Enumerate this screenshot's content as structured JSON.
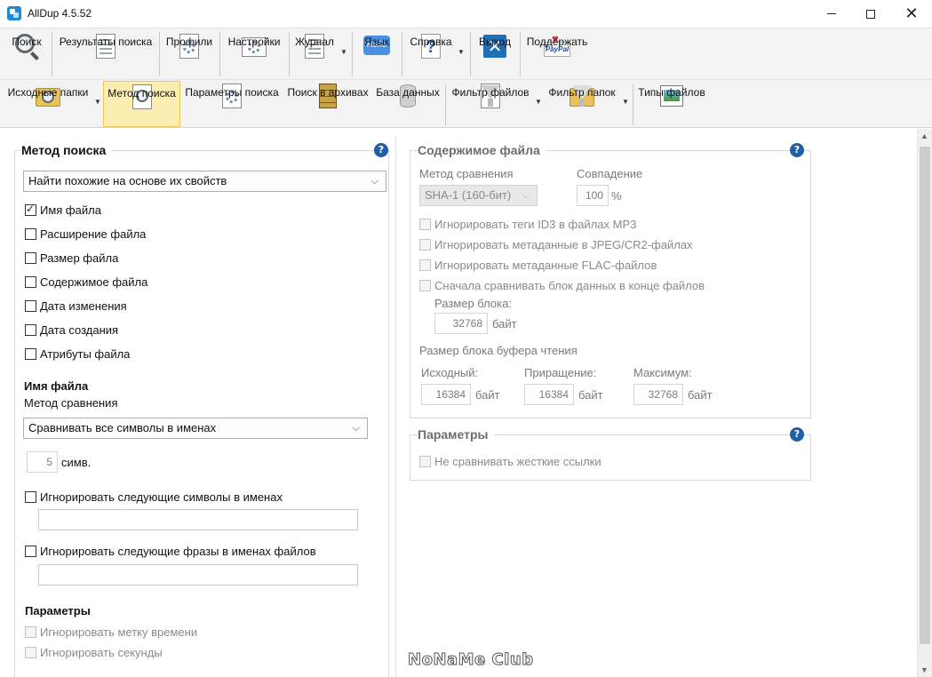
{
  "window": {
    "title": "AllDup 4.5.52"
  },
  "toolbar_main": [
    {
      "label": "Поиск"
    },
    {
      "label": "Результаты поиска"
    },
    {
      "label": "Профили"
    },
    {
      "label": "Настройки"
    },
    {
      "label": "Журнал"
    },
    {
      "label": "Язык"
    },
    {
      "label": "Справка"
    },
    {
      "label": "Выход"
    },
    {
      "label": "Поддержать"
    }
  ],
  "toolbar_sub": [
    {
      "label": "Исходные папки"
    },
    {
      "label": "Метод поиска"
    },
    {
      "label": "Параметры поиска"
    },
    {
      "label": "Поиск в архивах"
    },
    {
      "label": "База данных"
    },
    {
      "label": "Фильтр файлов"
    },
    {
      "label": "Фильтр папок"
    },
    {
      "label": "Типы файлов"
    }
  ],
  "language_icon_text": "Hello",
  "paypal_icon_text": "PayPal",
  "search_method": {
    "title": "Метод поиска",
    "mode_value": "Найти похожие на основе их свойств",
    "checks": [
      {
        "label": "Имя файла",
        "checked": true
      },
      {
        "label": "Расширение файла",
        "checked": false
      },
      {
        "label": "Размер файла",
        "checked": false
      },
      {
        "label": "Содержимое файла",
        "checked": false
      },
      {
        "label": "Дата изменения",
        "checked": false
      },
      {
        "label": "Дата создания",
        "checked": false
      },
      {
        "label": "Атрибуты файла",
        "checked": false
      }
    ],
    "filename_heading": "Имя файла",
    "compare_method_label": "Метод сравнения",
    "compare_method_value": "Сравнивать все символы в именах",
    "chars_value": "5",
    "chars_unit": "симв.",
    "ignore_chars_label": "Игнорировать следующие символы в именах",
    "ignore_chars_value": "",
    "ignore_phrases_label": "Игнорировать следующие фразы в именах файлов",
    "ignore_phrases_value": "",
    "params_heading": "Параметры",
    "ignore_timestamp_label": "Игнорировать метку времени",
    "ignore_seconds_label": "Игнорировать секунды"
  },
  "file_content": {
    "title": "Содержимое файла",
    "compare_method_label": "Метод сравнения",
    "compare_method_value": "SHA-1 (160-бит)",
    "match_label": "Совпадение",
    "match_value": "100",
    "match_unit": "%",
    "checks": [
      {
        "label": "Игнорировать теги ID3 в файлах MP3"
      },
      {
        "label": "Игнорировать метаданные в JPEG/CR2-файлах"
      },
      {
        "label": "Игнорировать метаданные FLAC-файлов"
      },
      {
        "label": "Сначала сравнивать блок данных в конце файлов"
      }
    ],
    "block_size_label": "Размер блока:",
    "block_size_value": "32768",
    "byte_unit": "байт",
    "buffer_label": "Размер блока буфера чтения",
    "initial_label": "Исходный:",
    "initial_value": "16384",
    "increment_label": "Приращение:",
    "increment_value": "16384",
    "max_label": "Максимум:",
    "max_value": "32768"
  },
  "params": {
    "title": "Параметры",
    "no_hardlinks_label": "Не сравнивать жесткие ссылки"
  },
  "help_glyph": "?",
  "watermark": "NoNaMe Club"
}
